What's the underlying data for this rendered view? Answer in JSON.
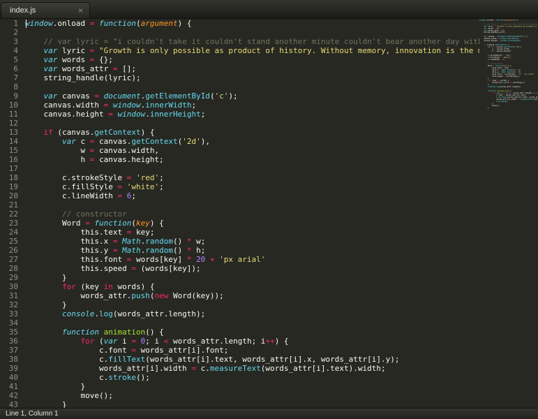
{
  "tab_bar": {
    "tab_label": "index.js",
    "close_label": "×"
  },
  "status_bar": {
    "text": "Line 1, Column 1"
  },
  "colors": {
    "background": "#272822",
    "foreground": "#f8f8f2",
    "keyword": "#f92672",
    "storage": "#66d9ef",
    "string": "#e6db74",
    "number": "#ae81ff",
    "comment": "#75715e",
    "function_name": "#a6e22e",
    "parameter": "#fd971f",
    "line_number": "#8f908a"
  },
  "code": {
    "language": "javascript",
    "lines": [
      {
        "n": "1",
        "tokens": [
          [
            "si",
            "window"
          ],
          [
            "w",
            ".onload "
          ],
          [
            "k",
            "="
          ],
          [
            "w",
            " "
          ],
          [
            "si",
            "function"
          ],
          [
            "w",
            "("
          ],
          [
            "o",
            "argument"
          ],
          [
            "w",
            ") {"
          ]
        ]
      },
      {
        "n": "2",
        "tokens": []
      },
      {
        "n": "3",
        "tokens": [
          [
            "c",
            "    // var lyric = \"i couldn't take it couldn't stand another minute couldn't bear another day without you"
          ]
        ]
      },
      {
        "n": "4",
        "tokens": [
          [
            "w",
            "    "
          ],
          [
            "si",
            "var"
          ],
          [
            "w",
            " lyric "
          ],
          [
            "k",
            "="
          ],
          [
            "w",
            " "
          ],
          [
            "s",
            "\"Growth is only possible as product of history. Without memory, innovation is the merely nov"
          ]
        ]
      },
      {
        "n": "5",
        "tokens": [
          [
            "w",
            "    "
          ],
          [
            "si",
            "var"
          ],
          [
            "w",
            " words "
          ],
          [
            "k",
            "="
          ],
          [
            "w",
            " {};"
          ]
        ]
      },
      {
        "n": "6",
        "tokens": [
          [
            "w",
            "    "
          ],
          [
            "si",
            "var"
          ],
          [
            "w",
            " words_attr "
          ],
          [
            "k",
            "="
          ],
          [
            "w",
            " [];"
          ]
        ]
      },
      {
        "n": "7",
        "tokens": [
          [
            "w",
            "    string_handle(lyric);"
          ]
        ]
      },
      {
        "n": "8",
        "tokens": []
      },
      {
        "n": "9",
        "tokens": [
          [
            "w",
            "    "
          ],
          [
            "si",
            "var"
          ],
          [
            "w",
            " canvas "
          ],
          [
            "k",
            "="
          ],
          [
            "w",
            " "
          ],
          [
            "si",
            "document"
          ],
          [
            "w",
            "."
          ],
          [
            "b",
            "getElementById"
          ],
          [
            "w",
            "("
          ],
          [
            "s",
            "'c'"
          ],
          [
            "w",
            ");"
          ]
        ]
      },
      {
        "n": "10",
        "tokens": [
          [
            "w",
            "    canvas.width "
          ],
          [
            "k",
            "="
          ],
          [
            "w",
            " "
          ],
          [
            "si",
            "window"
          ],
          [
            "w",
            "."
          ],
          [
            "b",
            "innerWidth"
          ],
          [
            "w",
            ";"
          ]
        ]
      },
      {
        "n": "11",
        "tokens": [
          [
            "w",
            "    canvas.height "
          ],
          [
            "k",
            "="
          ],
          [
            "w",
            " "
          ],
          [
            "si",
            "window"
          ],
          [
            "w",
            "."
          ],
          [
            "b",
            "innerHeight"
          ],
          [
            "w",
            ";"
          ]
        ]
      },
      {
        "n": "12",
        "tokens": []
      },
      {
        "n": "13",
        "tokens": [
          [
            "w",
            "    "
          ],
          [
            "k",
            "if"
          ],
          [
            "w",
            " (canvas."
          ],
          [
            "b",
            "getContext"
          ],
          [
            "w",
            ") {"
          ]
        ]
      },
      {
        "n": "14",
        "tokens": [
          [
            "w",
            "        "
          ],
          [
            "si",
            "var"
          ],
          [
            "w",
            " c "
          ],
          [
            "k",
            "="
          ],
          [
            "w",
            " canvas."
          ],
          [
            "b",
            "getContext"
          ],
          [
            "w",
            "("
          ],
          [
            "s",
            "'2d'"
          ],
          [
            "w",
            "),"
          ]
        ]
      },
      {
        "n": "15",
        "tokens": [
          [
            "w",
            "            w "
          ],
          [
            "k",
            "="
          ],
          [
            "w",
            " canvas.width,"
          ]
        ]
      },
      {
        "n": "16",
        "tokens": [
          [
            "w",
            "            h "
          ],
          [
            "k",
            "="
          ],
          [
            "w",
            " canvas.height;"
          ]
        ]
      },
      {
        "n": "17",
        "tokens": []
      },
      {
        "n": "18",
        "tokens": [
          [
            "w",
            "        c.strokeStyle "
          ],
          [
            "k",
            "="
          ],
          [
            "w",
            " "
          ],
          [
            "s",
            "'red'"
          ],
          [
            "w",
            ";"
          ]
        ]
      },
      {
        "n": "19",
        "tokens": [
          [
            "w",
            "        c.fillStyle "
          ],
          [
            "k",
            "="
          ],
          [
            "w",
            " "
          ],
          [
            "s",
            "'white'"
          ],
          [
            "w",
            ";"
          ]
        ]
      },
      {
        "n": "20",
        "tokens": [
          [
            "w",
            "        c.lineWidth "
          ],
          [
            "k",
            "="
          ],
          [
            "w",
            " "
          ],
          [
            "n",
            "6"
          ],
          [
            "w",
            ";"
          ]
        ]
      },
      {
        "n": "21",
        "tokens": []
      },
      {
        "n": "22",
        "tokens": [
          [
            "c",
            "        // constructor"
          ]
        ]
      },
      {
        "n": "23",
        "tokens": [
          [
            "w",
            "        Word "
          ],
          [
            "k",
            "="
          ],
          [
            "w",
            " "
          ],
          [
            "si",
            "function"
          ],
          [
            "w",
            "("
          ],
          [
            "o",
            "key"
          ],
          [
            "w",
            ") {"
          ]
        ]
      },
      {
        "n": "24",
        "tokens": [
          [
            "w",
            "            this.text "
          ],
          [
            "k",
            "="
          ],
          [
            "w",
            " key;"
          ]
        ]
      },
      {
        "n": "25",
        "tokens": [
          [
            "w",
            "            this.x "
          ],
          [
            "k",
            "="
          ],
          [
            "w",
            " "
          ],
          [
            "si",
            "Math"
          ],
          [
            "w",
            "."
          ],
          [
            "b",
            "random"
          ],
          [
            "w",
            "() "
          ],
          [
            "k",
            "*"
          ],
          [
            "w",
            " w;"
          ]
        ]
      },
      {
        "n": "26",
        "tokens": [
          [
            "w",
            "            this.y "
          ],
          [
            "k",
            "="
          ],
          [
            "w",
            " "
          ],
          [
            "si",
            "Math"
          ],
          [
            "w",
            "."
          ],
          [
            "b",
            "random"
          ],
          [
            "w",
            "() "
          ],
          [
            "k",
            "*"
          ],
          [
            "w",
            " h;"
          ]
        ]
      },
      {
        "n": "27",
        "tokens": [
          [
            "w",
            "            this.font "
          ],
          [
            "k",
            "="
          ],
          [
            "w",
            " words[key] "
          ],
          [
            "k",
            "*"
          ],
          [
            "w",
            " "
          ],
          [
            "n",
            "20"
          ],
          [
            "w",
            " "
          ],
          [
            "k",
            "+"
          ],
          [
            "w",
            " "
          ],
          [
            "s",
            "'px arial'"
          ]
        ]
      },
      {
        "n": "28",
        "tokens": [
          [
            "w",
            "            this.speed "
          ],
          [
            "k",
            "="
          ],
          [
            "w",
            " (words[key]);"
          ]
        ]
      },
      {
        "n": "29",
        "tokens": [
          [
            "w",
            "        }"
          ]
        ]
      },
      {
        "n": "30",
        "tokens": [
          [
            "w",
            "        "
          ],
          [
            "k",
            "for"
          ],
          [
            "w",
            " (key "
          ],
          [
            "k",
            "in"
          ],
          [
            "w",
            " words) {"
          ]
        ]
      },
      {
        "n": "31",
        "tokens": [
          [
            "w",
            "            words_attr."
          ],
          [
            "b",
            "push"
          ],
          [
            "w",
            "("
          ],
          [
            "k",
            "new"
          ],
          [
            "w",
            " Word(key));"
          ]
        ]
      },
      {
        "n": "32",
        "tokens": [
          [
            "w",
            "        }"
          ]
        ]
      },
      {
        "n": "33",
        "tokens": [
          [
            "w",
            "        "
          ],
          [
            "si",
            "console"
          ],
          [
            "w",
            "."
          ],
          [
            "b",
            "log"
          ],
          [
            "w",
            "(words_attr.length);"
          ]
        ]
      },
      {
        "n": "34",
        "tokens": []
      },
      {
        "n": "35",
        "tokens": [
          [
            "w",
            "        "
          ],
          [
            "si",
            "function"
          ],
          [
            "w",
            " "
          ],
          [
            "g",
            "animation"
          ],
          [
            "w",
            "() {"
          ]
        ]
      },
      {
        "n": "36",
        "tokens": [
          [
            "w",
            "            "
          ],
          [
            "k",
            "for"
          ],
          [
            "w",
            " ("
          ],
          [
            "si",
            "var"
          ],
          [
            "w",
            " i "
          ],
          [
            "k",
            "="
          ],
          [
            "w",
            " "
          ],
          [
            "n",
            "0"
          ],
          [
            "w",
            "; i "
          ],
          [
            "k",
            "<"
          ],
          [
            "w",
            " words_attr.length; i"
          ],
          [
            "k",
            "++"
          ],
          [
            "w",
            ") {"
          ]
        ]
      },
      {
        "n": "37",
        "tokens": [
          [
            "w",
            "                c.font "
          ],
          [
            "k",
            "="
          ],
          [
            "w",
            " words_attr[i].font;"
          ]
        ]
      },
      {
        "n": "38",
        "tokens": [
          [
            "w",
            "                c."
          ],
          [
            "b",
            "fillText"
          ],
          [
            "w",
            "(words_attr[i].text, words_attr[i].x, words_attr[i].y);"
          ]
        ]
      },
      {
        "n": "39",
        "tokens": [
          [
            "w",
            "                words_attr[i].width "
          ],
          [
            "k",
            "="
          ],
          [
            "w",
            " c."
          ],
          [
            "b",
            "measureText"
          ],
          [
            "w",
            "(words_attr[i].text).width;"
          ]
        ]
      },
      {
        "n": "40",
        "tokens": [
          [
            "w",
            "                c."
          ],
          [
            "b",
            "stroke"
          ],
          [
            "w",
            "();"
          ]
        ]
      },
      {
        "n": "41",
        "tokens": [
          [
            "w",
            "            }"
          ]
        ]
      },
      {
        "n": "42",
        "tokens": [
          [
            "w",
            "            move();"
          ]
        ]
      },
      {
        "n": "43",
        "tokens": [
          [
            "w",
            "        }"
          ]
        ]
      }
    ]
  }
}
